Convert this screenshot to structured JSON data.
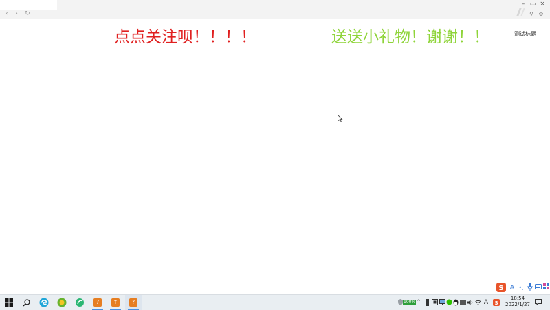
{
  "window": {
    "nav_back": "‹",
    "nav_forward": "›",
    "nav_refresh": "↻",
    "min": "–",
    "max": "▭",
    "close": "×",
    "pin": "⚲",
    "settings": "⚙"
  },
  "banners": {
    "left": "点点关注呗！！！！",
    "right": "送送小礼物！谢谢！！"
  },
  "corner_label": "测试标题",
  "taskbar": {
    "battery": "100%",
    "clock_time": "18:54",
    "clock_date": "2022/1/27"
  },
  "ime": {
    "sogou": "S",
    "lang": "A",
    "punct": "•,",
    "mic": "🎤"
  },
  "colors": {
    "banner_left": "#e02020",
    "banner_right": "#8fd43a",
    "accent": "#4a90e2"
  }
}
